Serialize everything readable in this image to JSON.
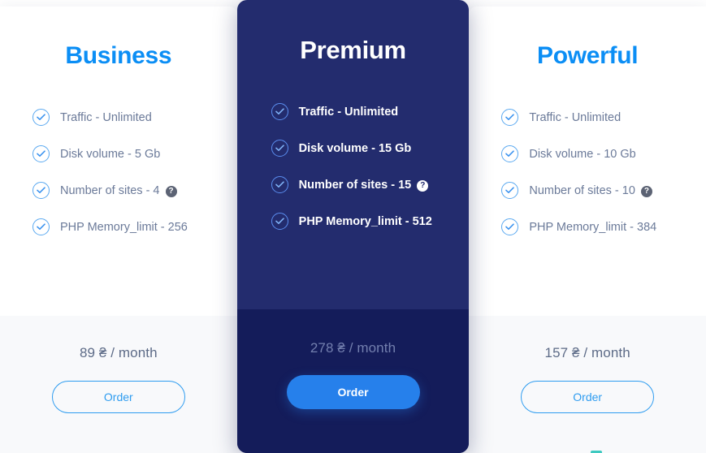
{
  "plans": [
    {
      "id": "business",
      "featured": false,
      "title": "Business",
      "features": [
        {
          "label": "Traffic - Unlimited",
          "help": false
        },
        {
          "label": "Disk volume - 5 Gb",
          "help": false
        },
        {
          "label": "Number of sites - 4",
          "help": true
        },
        {
          "label": "PHP Memory_limit - 256",
          "help": false
        }
      ],
      "price": "89 ₴ / month",
      "order_label": "Order"
    },
    {
      "id": "premium",
      "featured": true,
      "title": "Premium",
      "features": [
        {
          "label": "Traffic - Unlimited",
          "help": false
        },
        {
          "label": "Disk volume - 15 Gb",
          "help": false
        },
        {
          "label": "Number of sites - 15",
          "help": true
        },
        {
          "label": "PHP Memory_limit - 512",
          "help": false
        }
      ],
      "price": "278 ₴ / month",
      "order_label": "Order"
    },
    {
      "id": "powerful",
      "featured": false,
      "title": "Powerful",
      "features": [
        {
          "label": "Traffic - Unlimited",
          "help": false
        },
        {
          "label": "Disk volume - 10 Gb",
          "help": false
        },
        {
          "label": "Number of sites - 10",
          "help": true
        },
        {
          "label": "PHP Memory_limit - 384",
          "help": false
        }
      ],
      "price": "157 ₴ / month",
      "order_label": "Order"
    }
  ],
  "icons": {
    "check": "check-circle-icon",
    "help": "help-question-icon",
    "help_glyph": "?"
  },
  "colors": {
    "accent_blue": "#0b8ef5",
    "button_blue": "#2680eb",
    "featured_bg": "#232c6e",
    "featured_foot_bg": "#141c5a",
    "body_text": "#6b7a99",
    "price_text": "#5d6b87",
    "footer_bg": "#f8f9fb",
    "marker_teal": "#3ec9c0"
  }
}
